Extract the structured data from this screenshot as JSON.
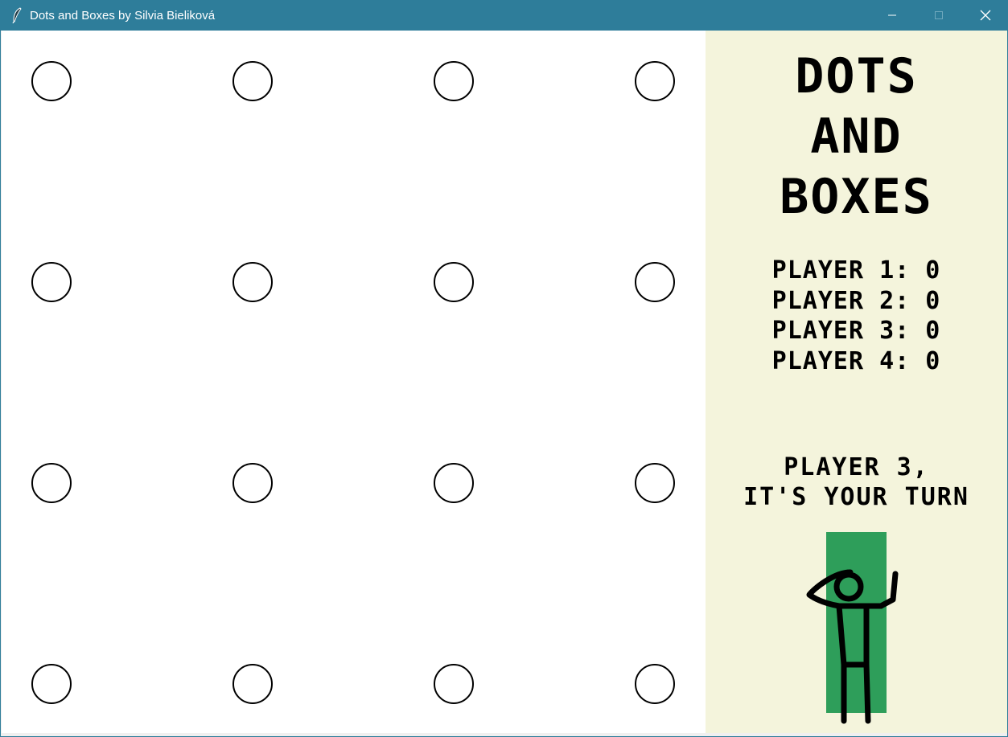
{
  "window": {
    "title": "Dots and Boxes by Silvia Bieliková",
    "icon": "feather-icon",
    "controls": [
      "minimize-icon",
      "maximize-icon",
      "close-icon"
    ],
    "titlebar_color": "#2e7d9a"
  },
  "board": {
    "rows": 4,
    "cols": 4,
    "dot_style": "hollow black circle",
    "background": "#ffffff"
  },
  "sidebar": {
    "background": "#f4f4dc",
    "title_lines": [
      "DOTS",
      "AND",
      "BOXES"
    ],
    "scores": [
      {
        "label": "PLAYER 1:",
        "value": "0"
      },
      {
        "label": "PLAYER 2:",
        "value": "0"
      },
      {
        "label": "PLAYER 3:",
        "value": "0"
      },
      {
        "label": "PLAYER 4:",
        "value": "0"
      }
    ],
    "turn_lines": [
      "PLAYER 3,",
      "IT'S YOUR TURN"
    ],
    "figure": {
      "icon": "stick-figure-icon",
      "panel_color": "#2e9e5a"
    }
  }
}
